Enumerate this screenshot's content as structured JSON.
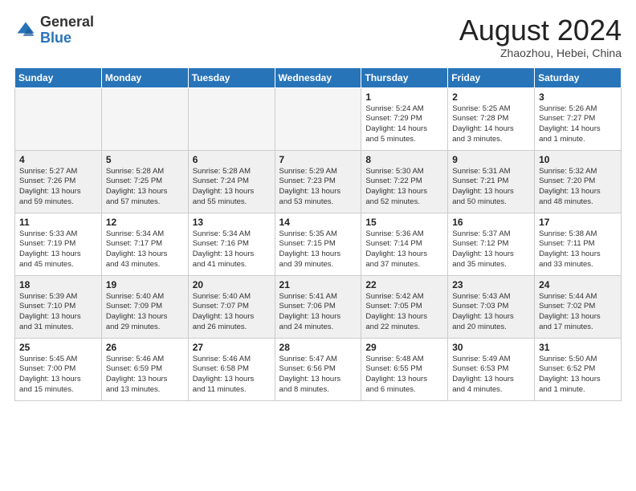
{
  "header": {
    "logo_general": "General",
    "logo_blue": "Blue",
    "month": "August 2024",
    "location": "Zhaozhou, Hebei, China"
  },
  "weekdays": [
    "Sunday",
    "Monday",
    "Tuesday",
    "Wednesday",
    "Thursday",
    "Friday",
    "Saturday"
  ],
  "weeks": [
    [
      {
        "num": "",
        "info": ""
      },
      {
        "num": "",
        "info": ""
      },
      {
        "num": "",
        "info": ""
      },
      {
        "num": "",
        "info": ""
      },
      {
        "num": "1",
        "info": "Sunrise: 5:24 AM\nSunset: 7:29 PM\nDaylight: 14 hours\nand 5 minutes."
      },
      {
        "num": "2",
        "info": "Sunrise: 5:25 AM\nSunset: 7:28 PM\nDaylight: 14 hours\nand 3 minutes."
      },
      {
        "num": "3",
        "info": "Sunrise: 5:26 AM\nSunset: 7:27 PM\nDaylight: 14 hours\nand 1 minute."
      }
    ],
    [
      {
        "num": "4",
        "info": "Sunrise: 5:27 AM\nSunset: 7:26 PM\nDaylight: 13 hours\nand 59 minutes."
      },
      {
        "num": "5",
        "info": "Sunrise: 5:28 AM\nSunset: 7:25 PM\nDaylight: 13 hours\nand 57 minutes."
      },
      {
        "num": "6",
        "info": "Sunrise: 5:28 AM\nSunset: 7:24 PM\nDaylight: 13 hours\nand 55 minutes."
      },
      {
        "num": "7",
        "info": "Sunrise: 5:29 AM\nSunset: 7:23 PM\nDaylight: 13 hours\nand 53 minutes."
      },
      {
        "num": "8",
        "info": "Sunrise: 5:30 AM\nSunset: 7:22 PM\nDaylight: 13 hours\nand 52 minutes."
      },
      {
        "num": "9",
        "info": "Sunrise: 5:31 AM\nSunset: 7:21 PM\nDaylight: 13 hours\nand 50 minutes."
      },
      {
        "num": "10",
        "info": "Sunrise: 5:32 AM\nSunset: 7:20 PM\nDaylight: 13 hours\nand 48 minutes."
      }
    ],
    [
      {
        "num": "11",
        "info": "Sunrise: 5:33 AM\nSunset: 7:19 PM\nDaylight: 13 hours\nand 45 minutes."
      },
      {
        "num": "12",
        "info": "Sunrise: 5:34 AM\nSunset: 7:17 PM\nDaylight: 13 hours\nand 43 minutes."
      },
      {
        "num": "13",
        "info": "Sunrise: 5:34 AM\nSunset: 7:16 PM\nDaylight: 13 hours\nand 41 minutes."
      },
      {
        "num": "14",
        "info": "Sunrise: 5:35 AM\nSunset: 7:15 PM\nDaylight: 13 hours\nand 39 minutes."
      },
      {
        "num": "15",
        "info": "Sunrise: 5:36 AM\nSunset: 7:14 PM\nDaylight: 13 hours\nand 37 minutes."
      },
      {
        "num": "16",
        "info": "Sunrise: 5:37 AM\nSunset: 7:12 PM\nDaylight: 13 hours\nand 35 minutes."
      },
      {
        "num": "17",
        "info": "Sunrise: 5:38 AM\nSunset: 7:11 PM\nDaylight: 13 hours\nand 33 minutes."
      }
    ],
    [
      {
        "num": "18",
        "info": "Sunrise: 5:39 AM\nSunset: 7:10 PM\nDaylight: 13 hours\nand 31 minutes."
      },
      {
        "num": "19",
        "info": "Sunrise: 5:40 AM\nSunset: 7:09 PM\nDaylight: 13 hours\nand 29 minutes."
      },
      {
        "num": "20",
        "info": "Sunrise: 5:40 AM\nSunset: 7:07 PM\nDaylight: 13 hours\nand 26 minutes."
      },
      {
        "num": "21",
        "info": "Sunrise: 5:41 AM\nSunset: 7:06 PM\nDaylight: 13 hours\nand 24 minutes."
      },
      {
        "num": "22",
        "info": "Sunrise: 5:42 AM\nSunset: 7:05 PM\nDaylight: 13 hours\nand 22 minutes."
      },
      {
        "num": "23",
        "info": "Sunrise: 5:43 AM\nSunset: 7:03 PM\nDaylight: 13 hours\nand 20 minutes."
      },
      {
        "num": "24",
        "info": "Sunrise: 5:44 AM\nSunset: 7:02 PM\nDaylight: 13 hours\nand 17 minutes."
      }
    ],
    [
      {
        "num": "25",
        "info": "Sunrise: 5:45 AM\nSunset: 7:00 PM\nDaylight: 13 hours\nand 15 minutes."
      },
      {
        "num": "26",
        "info": "Sunrise: 5:46 AM\nSunset: 6:59 PM\nDaylight: 13 hours\nand 13 minutes."
      },
      {
        "num": "27",
        "info": "Sunrise: 5:46 AM\nSunset: 6:58 PM\nDaylight: 13 hours\nand 11 minutes."
      },
      {
        "num": "28",
        "info": "Sunrise: 5:47 AM\nSunset: 6:56 PM\nDaylight: 13 hours\nand 8 minutes."
      },
      {
        "num": "29",
        "info": "Sunrise: 5:48 AM\nSunset: 6:55 PM\nDaylight: 13 hours\nand 6 minutes."
      },
      {
        "num": "30",
        "info": "Sunrise: 5:49 AM\nSunset: 6:53 PM\nDaylight: 13 hours\nand 4 minutes."
      },
      {
        "num": "31",
        "info": "Sunrise: 5:50 AM\nSunset: 6:52 PM\nDaylight: 13 hours\nand 1 minute."
      }
    ]
  ]
}
